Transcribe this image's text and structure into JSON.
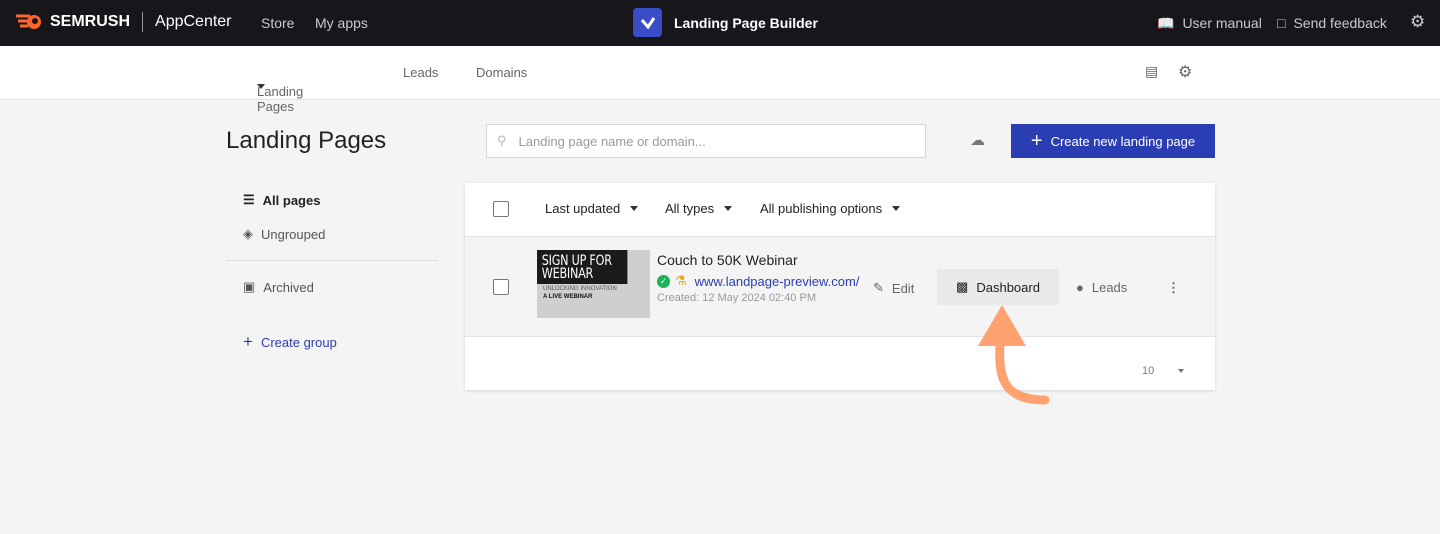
{
  "topbar": {
    "brand": "SEMRUSH",
    "product": "AppCenter",
    "nav": [
      "Store",
      "My apps"
    ],
    "app_title": "Landing Page Builder",
    "user_manual": "User manual",
    "send_feedback": "Send feedback"
  },
  "subnav": {
    "tabs": [
      "Landing Pages",
      "Leads",
      "Domains"
    ]
  },
  "page": {
    "title": "Landing Pages",
    "search_placeholder": "Landing page name or domain...",
    "create_button": "Create new landing page"
  },
  "sidebar": {
    "items": [
      {
        "label": "All pages",
        "icon": "list-icon"
      },
      {
        "label": "Ungrouped",
        "icon": "layers-icon"
      },
      {
        "label": "Archived",
        "icon": "archive-icon"
      }
    ],
    "create_group": "Create group"
  },
  "filters": {
    "sort": "Last updated",
    "types": "All types",
    "publishing": "All publishing options"
  },
  "rows": [
    {
      "title": "Couch to 50K Webinar",
      "url": "www.landpage-preview.com/",
      "created": "Created: 12 May 2024 02:40 PM",
      "thumb_heading": "SIGN UP FOR WEBINAR",
      "thumb_sub": "UNLOCKING INNOVATION",
      "thumb_tag": "A LIVE WEBINAR",
      "actions": {
        "edit": "Edit",
        "dashboard": "Dashboard",
        "leads": "Leads"
      }
    }
  ],
  "pagination": {
    "per_page": "10"
  },
  "colors": {
    "accent": "#2b3db3",
    "brand": "#ff642d",
    "annotation_arrow": "#ffa270"
  }
}
